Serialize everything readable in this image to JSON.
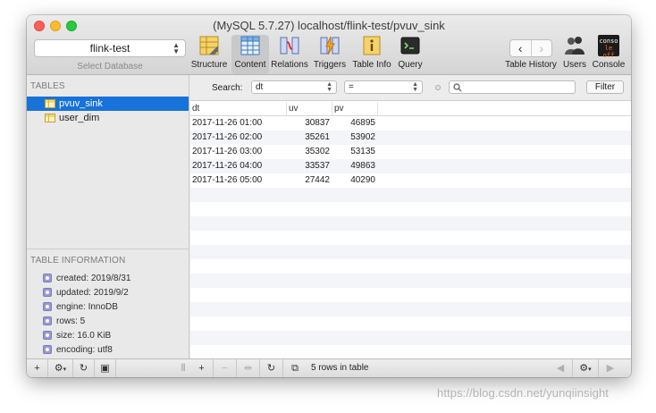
{
  "window": {
    "title": "(MySQL 5.7.27) localhost/flink-test/pvuv_sink"
  },
  "database": {
    "selected": "flink-test",
    "label": "Select Database"
  },
  "toolbar": {
    "structure": "Structure",
    "content": "Content",
    "relations": "Relations",
    "triggers": "Triggers",
    "table_info": "Table Info",
    "query": "Query",
    "table_history": "Table History",
    "users": "Users",
    "console": "Console",
    "console_icon_text_1": "conso",
    "console_icon_text_2": "le off"
  },
  "sidebar": {
    "tables_header": "TABLES",
    "tables": [
      {
        "name": "pvuv_sink"
      },
      {
        "name": "user_dim"
      }
    ],
    "info_header": "TABLE INFORMATION",
    "info": [
      "created: 2019/8/31",
      "updated: 2019/9/2",
      "engine: InnoDB",
      "rows: 5",
      "size: 16.0 KiB",
      "encoding: utf8"
    ]
  },
  "search": {
    "label": "Search:",
    "field": "dt",
    "operator": "=",
    "value": "",
    "filter_button": "Filter"
  },
  "table": {
    "columns": [
      "dt",
      "uv",
      "pv"
    ],
    "rows": [
      [
        "2017-11-26 01:00",
        "30837",
        "46895"
      ],
      [
        "2017-11-26 02:00",
        "35261",
        "53902"
      ],
      [
        "2017-11-26 03:00",
        "35302",
        "53135"
      ],
      [
        "2017-11-26 04:00",
        "33537",
        "49863"
      ],
      [
        "2017-11-26 05:00",
        "27442",
        "40290"
      ]
    ]
  },
  "statusbar": {
    "rows_text": "5 rows in table"
  },
  "watermark": "https://blog.csdn.net/yunqiinsight"
}
